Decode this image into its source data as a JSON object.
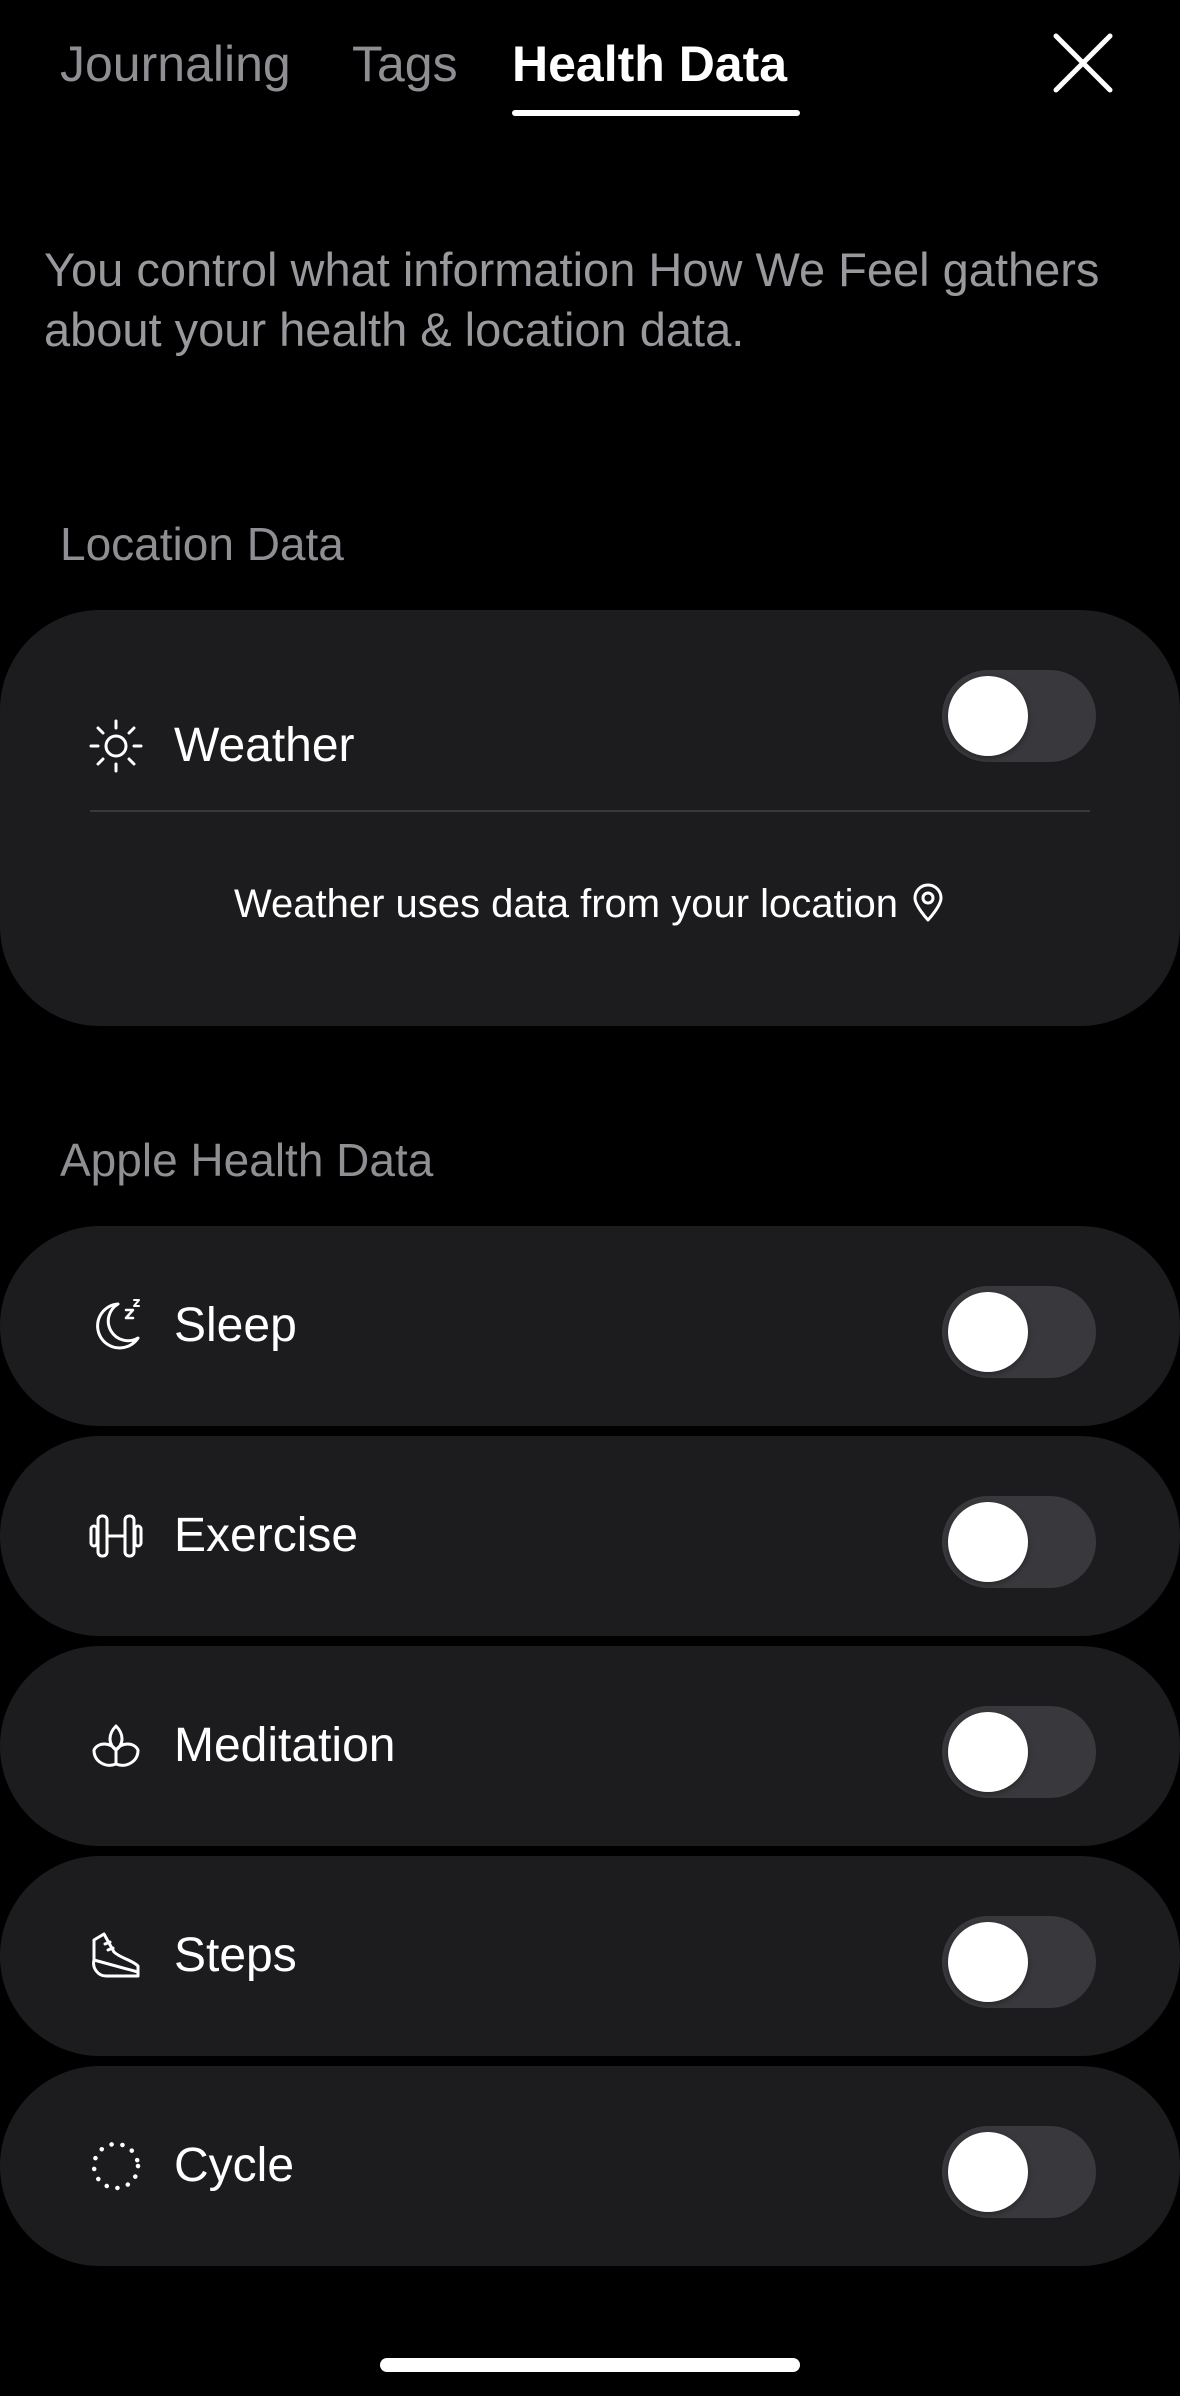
{
  "tabs": {
    "journaling": "Journaling",
    "tags": "Tags",
    "health_data": "Health Data",
    "active": "health_data"
  },
  "intro_text": "You control what information How We Feel gathers about your health & location data.",
  "location_section": {
    "title": "Location Data",
    "weather": {
      "label": "Weather",
      "icon": "sun-icon",
      "enabled": false
    },
    "note": "Weather uses data from your location",
    "note_icon": "location-pin-icon"
  },
  "health_section": {
    "title": "Apple Health Data",
    "items": [
      {
        "label": "Sleep",
        "icon": "moon-icon",
        "enabled": false
      },
      {
        "label": "Exercise",
        "icon": "dumbbell-icon",
        "enabled": false
      },
      {
        "label": "Meditation",
        "icon": "lotus-icon",
        "enabled": false
      },
      {
        "label": "Steps",
        "icon": "shoe-icon",
        "enabled": false
      },
      {
        "label": "Cycle",
        "icon": "dotted-circle-icon",
        "enabled": false
      }
    ]
  },
  "colors": {
    "background": "#000000",
    "card": "#1c1c1e",
    "toggle_off": "#39393d",
    "secondary_text": "#8e8e93"
  }
}
